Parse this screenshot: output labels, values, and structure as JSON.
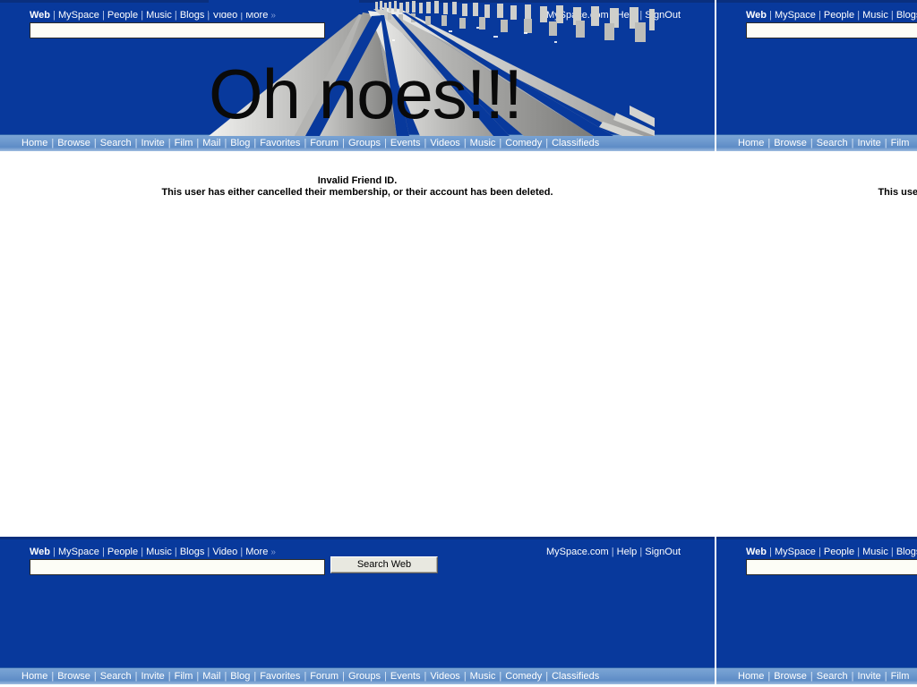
{
  "page": {
    "site": "MySpace",
    "overlay_text": "Oh noes!!!"
  },
  "search_header": {
    "scopes": [
      {
        "label": "Web",
        "active": true
      },
      {
        "label": "MySpace",
        "active": false
      },
      {
        "label": "People",
        "active": false
      },
      {
        "label": "Music",
        "active": false
      },
      {
        "label": "Blogs",
        "active": false
      },
      {
        "label": "Video",
        "active": false
      },
      {
        "label": "More",
        "active": false
      }
    ],
    "more_chevron": "»",
    "separator": "|",
    "account_links": [
      "MySpace.com",
      "Help",
      "SignOut"
    ],
    "search_value": "",
    "search_placeholder": "",
    "search_button_label": "Search Web"
  },
  "navbar": {
    "items": [
      "Home",
      "Browse",
      "Search",
      "Invite",
      "Film",
      "Mail",
      "Blog",
      "Favorites",
      "Forum",
      "Groups",
      "Events",
      "Videos",
      "Music",
      "Comedy",
      "Classifieds"
    ],
    "separator": "|"
  },
  "content": {
    "error_title": "Invalid Friend ID.",
    "error_body": "This user has either cancelled their membership, or their account has been deleted."
  },
  "colors": {
    "header_blue": "#08399c",
    "navbar_blue": "#6f9bcf",
    "link_white": "#ffffff",
    "page_white": "#ffffff",
    "text_black": "#000000"
  }
}
